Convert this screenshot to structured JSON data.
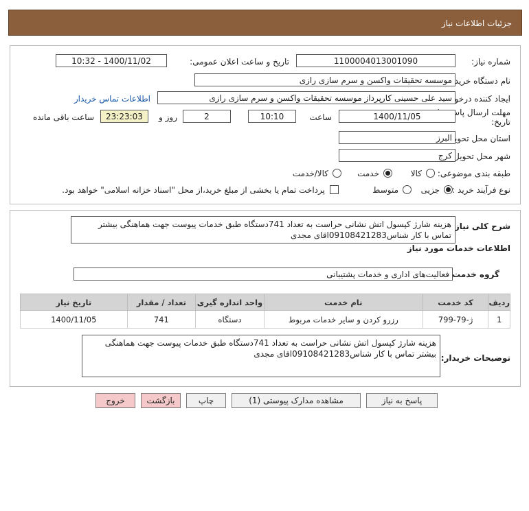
{
  "header": {
    "title": "جزئیات اطلاعات نیاز"
  },
  "info": {
    "need_number_label": "شماره نیاز:",
    "need_number": "1100004013001090",
    "announce_label": "تاریخ و ساعت اعلان عمومی:",
    "announce_value": "1400/11/02 - 10:32",
    "buyer_org_label": "نام دستگاه خریدار:",
    "buyer_org": "موسسه تحقیقات واکسن و سرم سازی رازی",
    "requester_label": "ایجاد کننده درخواست:",
    "requester": "سید علی  حسینی کارپرداز موسسه تحقیقات واکسن و سرم سازی رازی",
    "contact_link": "اطلاعات تماس خریدار",
    "deadline_label_line1": "مهلت ارسال پاسخ: تا",
    "deadline_label_line2": "تاریخ:",
    "deadline_date": "1400/11/05",
    "time_label": "ساعت",
    "deadline_time": "10:10",
    "days_value": "2",
    "days_label": "روز و",
    "remaining_time": "23:23:03",
    "remaining_label": "ساعت باقی مانده",
    "province_label": "استان محل تحویل:",
    "province": "البرز",
    "city_label": "شهر محل تحویل:",
    "city": "کرج",
    "category_label": "طبقه بندی موضوعی:",
    "category_options": [
      "کالا",
      "خدمت",
      "کالا/خدمت"
    ],
    "category_selected": "خدمت",
    "process_label": "نوع فرآیند خرید :",
    "process_options": [
      "جزیی",
      "متوسط"
    ],
    "process_selected": "جزیی",
    "payment_note": "پرداخت تمام یا بخشی از مبلغ خرید،از محل \"اسناد خزانه اسلامی\" خواهد بود."
  },
  "summary": {
    "label": "شرح کلی نیاز:",
    "text": "هزینه شارژ کپسول اتش نشانی حراست به تعداد 741دستگاه طبق خدمات پیوست جهت هماهنگی بیشتر\nتماس با کار شناس09108421283اقای مجدی"
  },
  "services": {
    "section_title": "اطلاعات خدمات مورد نیاز",
    "group_label": "گروه خدمت:",
    "group_value": "فعالیت‌های اداری و خدمات پشتیبانی",
    "table": {
      "headers": [
        "ردیف",
        "کد خدمت",
        "نام خدمت",
        "واحد اندازه گیری",
        "تعداد / مقدار",
        "تاریخ نیاز"
      ],
      "rows": [
        [
          "1",
          "ژ-79-799",
          "رزرو کردن و سایر خدمات مربوط",
          "دستگاه",
          "741",
          "1400/11/05"
        ]
      ]
    },
    "buyer_notes_label": "توضیحات خریدار:",
    "buyer_notes": "هزینه شارژ کپسول اتش نشانی حراست به تعداد 741دستگاه طبق خدمات پیوست جهت هماهنگی\nبیشتر تماس با کار شناس09108421283اقای مجدی"
  },
  "buttons": {
    "reply": "پاسخ به نیاز",
    "attachments": "مشاهده مدارک پیوستی (1)",
    "print": "چاپ",
    "back": "بازگشت",
    "exit": "خروج"
  },
  "colors": {
    "header_bg": "#8b5e3c",
    "link": "#1a5aa8",
    "remaining_bg": "#f3f1c5",
    "danger_button": "#f5c9c9"
  }
}
